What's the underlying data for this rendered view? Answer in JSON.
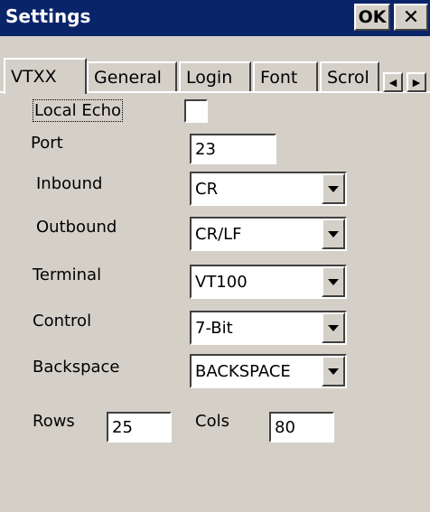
{
  "window": {
    "title": "Settings",
    "ok_label": "OK",
    "close_label": "✕"
  },
  "tabs": [
    {
      "label": "VTXX",
      "active": true
    },
    {
      "label": "General"
    },
    {
      "label": "Login"
    },
    {
      "label": "Font"
    },
    {
      "label": "Scrol"
    }
  ],
  "tab_scroll": {
    "left_icon": "◀",
    "right_icon": "▶"
  },
  "form": {
    "local_echo": {
      "label": "Local Echo",
      "checked": false
    },
    "port": {
      "label": "Port",
      "value": "23"
    },
    "inbound": {
      "label": "Inbound",
      "value": "CR"
    },
    "outbound": {
      "label": "Outbound",
      "value": "CR/LF"
    },
    "terminal": {
      "label": "Terminal",
      "value": "VT100"
    },
    "control": {
      "label": "Control",
      "value": "7-Bit"
    },
    "backspace": {
      "label": "Backspace",
      "value": "BACKSPACE"
    },
    "rows": {
      "label": "Rows",
      "value": "25"
    },
    "cols": {
      "label": "Cols",
      "value": "80"
    }
  },
  "colors": {
    "titlebar": "#0a246a",
    "surface": "#d4d0c8"
  }
}
